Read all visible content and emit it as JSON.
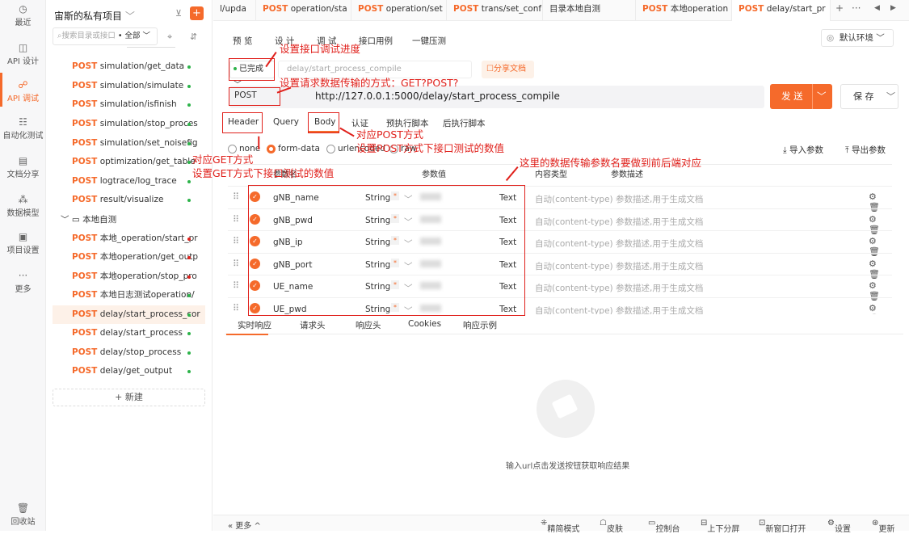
{
  "leftnav": [
    {
      "name": "recent",
      "label": "最近",
      "icon": "clock-icon"
    },
    {
      "name": "api-design",
      "label": "API 设计",
      "icon": "design-icon"
    },
    {
      "name": "api-debug",
      "label": "API 调试",
      "icon": "debug-icon"
    },
    {
      "name": "auto-test",
      "label": "自动化测试",
      "icon": "test-icon"
    },
    {
      "name": "doc-share",
      "label": "文档分享",
      "icon": "doc-icon"
    },
    {
      "name": "data-model",
      "label": "数据模型",
      "icon": "model-icon"
    },
    {
      "name": "project-settings",
      "label": "项目设置",
      "icon": "settings-icon"
    },
    {
      "name": "more",
      "label": "更多",
      "icon": "more-icon"
    }
  ],
  "trash": {
    "label": "回收站"
  },
  "sidebar": {
    "project_title": "宙斯的私有项目",
    "search_placeholder": "搜索目录或接口",
    "filter_label": "全部",
    "folder_label": "本地自测",
    "new_label": "+ 新建",
    "items": [
      {
        "method": "POST",
        "path": "simulation/get_data",
        "dot": "#2db34a"
      },
      {
        "method": "POST",
        "path": "simulation/simulate",
        "dot": "#2db34a"
      },
      {
        "method": "POST",
        "path": "simulation/isfinish",
        "dot": "#2db34a"
      },
      {
        "method": "POST",
        "path": "simulation/stop_proces",
        "dot": "#2db34a"
      },
      {
        "method": "POST",
        "path": "simulation/set_noisefig",
        "dot": "#2db34a"
      },
      {
        "method": "POST",
        "path": "optimization/get_table",
        "dot": "#2db34a"
      },
      {
        "method": "POST",
        "path": "logtrace/log_trace",
        "dot": "#2db34a"
      },
      {
        "method": "POST",
        "path": "result/visualize",
        "dot": "#2db34a"
      },
      {
        "method": "POST",
        "path": "本地_operation/start_pr",
        "dot": "#e0211c"
      },
      {
        "method": "POST",
        "path": "本地operation/get_outp",
        "dot": "#e0211c"
      },
      {
        "method": "POST",
        "path": "本地operation/stop_pro",
        "dot": "#e0211c"
      },
      {
        "method": "POST",
        "path": "本地日志测试operation/",
        "dot": "#2db34a"
      },
      {
        "method": "POST",
        "path": "delay/start_process_cor",
        "dot": "#2db34a"
      },
      {
        "method": "POST",
        "path": "delay/start_process",
        "dot": "#2db34a"
      },
      {
        "method": "POST",
        "path": "delay/stop_process",
        "dot": "#2db34a"
      },
      {
        "method": "POST",
        "path": "delay/get_output",
        "dot": "#2db34a"
      }
    ]
  },
  "tabs": [
    {
      "method": "",
      "label": "l/upda"
    },
    {
      "method": "POST",
      "label": "operation/sta"
    },
    {
      "method": "POST",
      "label": "operation/set"
    },
    {
      "method": "POST",
      "label": "trans/set_conf"
    },
    {
      "method": "",
      "label": "目录本地自测"
    },
    {
      "method": "POST",
      "label": "本地operation"
    },
    {
      "method": "POST",
      "label": "delay/start_pr"
    }
  ],
  "subnav": [
    "预 览",
    "设 计",
    "调 试",
    "接口用例",
    "一键压测"
  ],
  "environment": "默认环境",
  "request": {
    "status": "已完成",
    "name_placeholder": "delay/start_process_compile",
    "share_label": "分享文档",
    "method": "POST",
    "url": "http://127.0.0.1:5000/delay/start_process_compile",
    "send_label": "发 送",
    "save_label": "保 存"
  },
  "request_tabs": [
    "Header",
    "Query",
    "Body",
    "认证",
    "预执行脚本",
    "后执行脚本"
  ],
  "body_types": [
    "none",
    "form-data",
    "urlencoded",
    "raw"
  ],
  "import_label": "导入参数",
  "export_label": "导出参数",
  "table": {
    "headers": [
      "参数名",
      "参数值",
      "内容类型",
      "参数描述"
    ],
    "rows": [
      {
        "name": "gNB_name",
        "type": "String",
        "vtype": "Text",
        "ctype": "自动(content-type)",
        "desc": "参数描述,用于生成文档"
      },
      {
        "name": "gNB_pwd",
        "type": "String",
        "vtype": "Text",
        "ctype": "自动(content-type)",
        "desc": "参数描述,用于生成文档"
      },
      {
        "name": "gNB_ip",
        "type": "String",
        "vtype": "Text",
        "ctype": "自动(content-type)",
        "desc": "参数描述,用于生成文档"
      },
      {
        "name": "gNB_port",
        "type": "String",
        "vtype": "Text",
        "ctype": "自动(content-type)",
        "desc": "参数描述,用于生成文档"
      },
      {
        "name": "UE_name",
        "type": "String",
        "vtype": "Text",
        "ctype": "自动(content-type)",
        "desc": "参数描述,用于生成文档"
      },
      {
        "name": "UE_pwd",
        "type": "String",
        "vtype": "Text",
        "ctype": "自动(content-type)",
        "desc": "参数描述,用于生成文档"
      }
    ]
  },
  "response_tabs": [
    "实时响应",
    "请求头",
    "响应头",
    "Cookies",
    "响应示例"
  ],
  "empty_text": "输入url点击发送按钮获取响应结果",
  "footer": {
    "more": "« 更多 ^",
    "items": [
      "精简模式",
      "皮肤",
      "控制台",
      "上下分屏",
      "新窗口打开",
      "设置",
      "更新"
    ]
  },
  "annotations": {
    "progress": "设置接口调试进度",
    "method": "设置请求数据传输的方式：GET?POST?",
    "post": "对应POST方式",
    "post_values": "设置POST方式下接口测试的数值",
    "get": "对应GET方式",
    "get_values": "设置GET方式下接口测试的数值",
    "names": "这里的数据传输参数名要做到前后端对应"
  },
  "colors": {
    "accent": "#f56a2b",
    "annotation": "#e0211c"
  }
}
